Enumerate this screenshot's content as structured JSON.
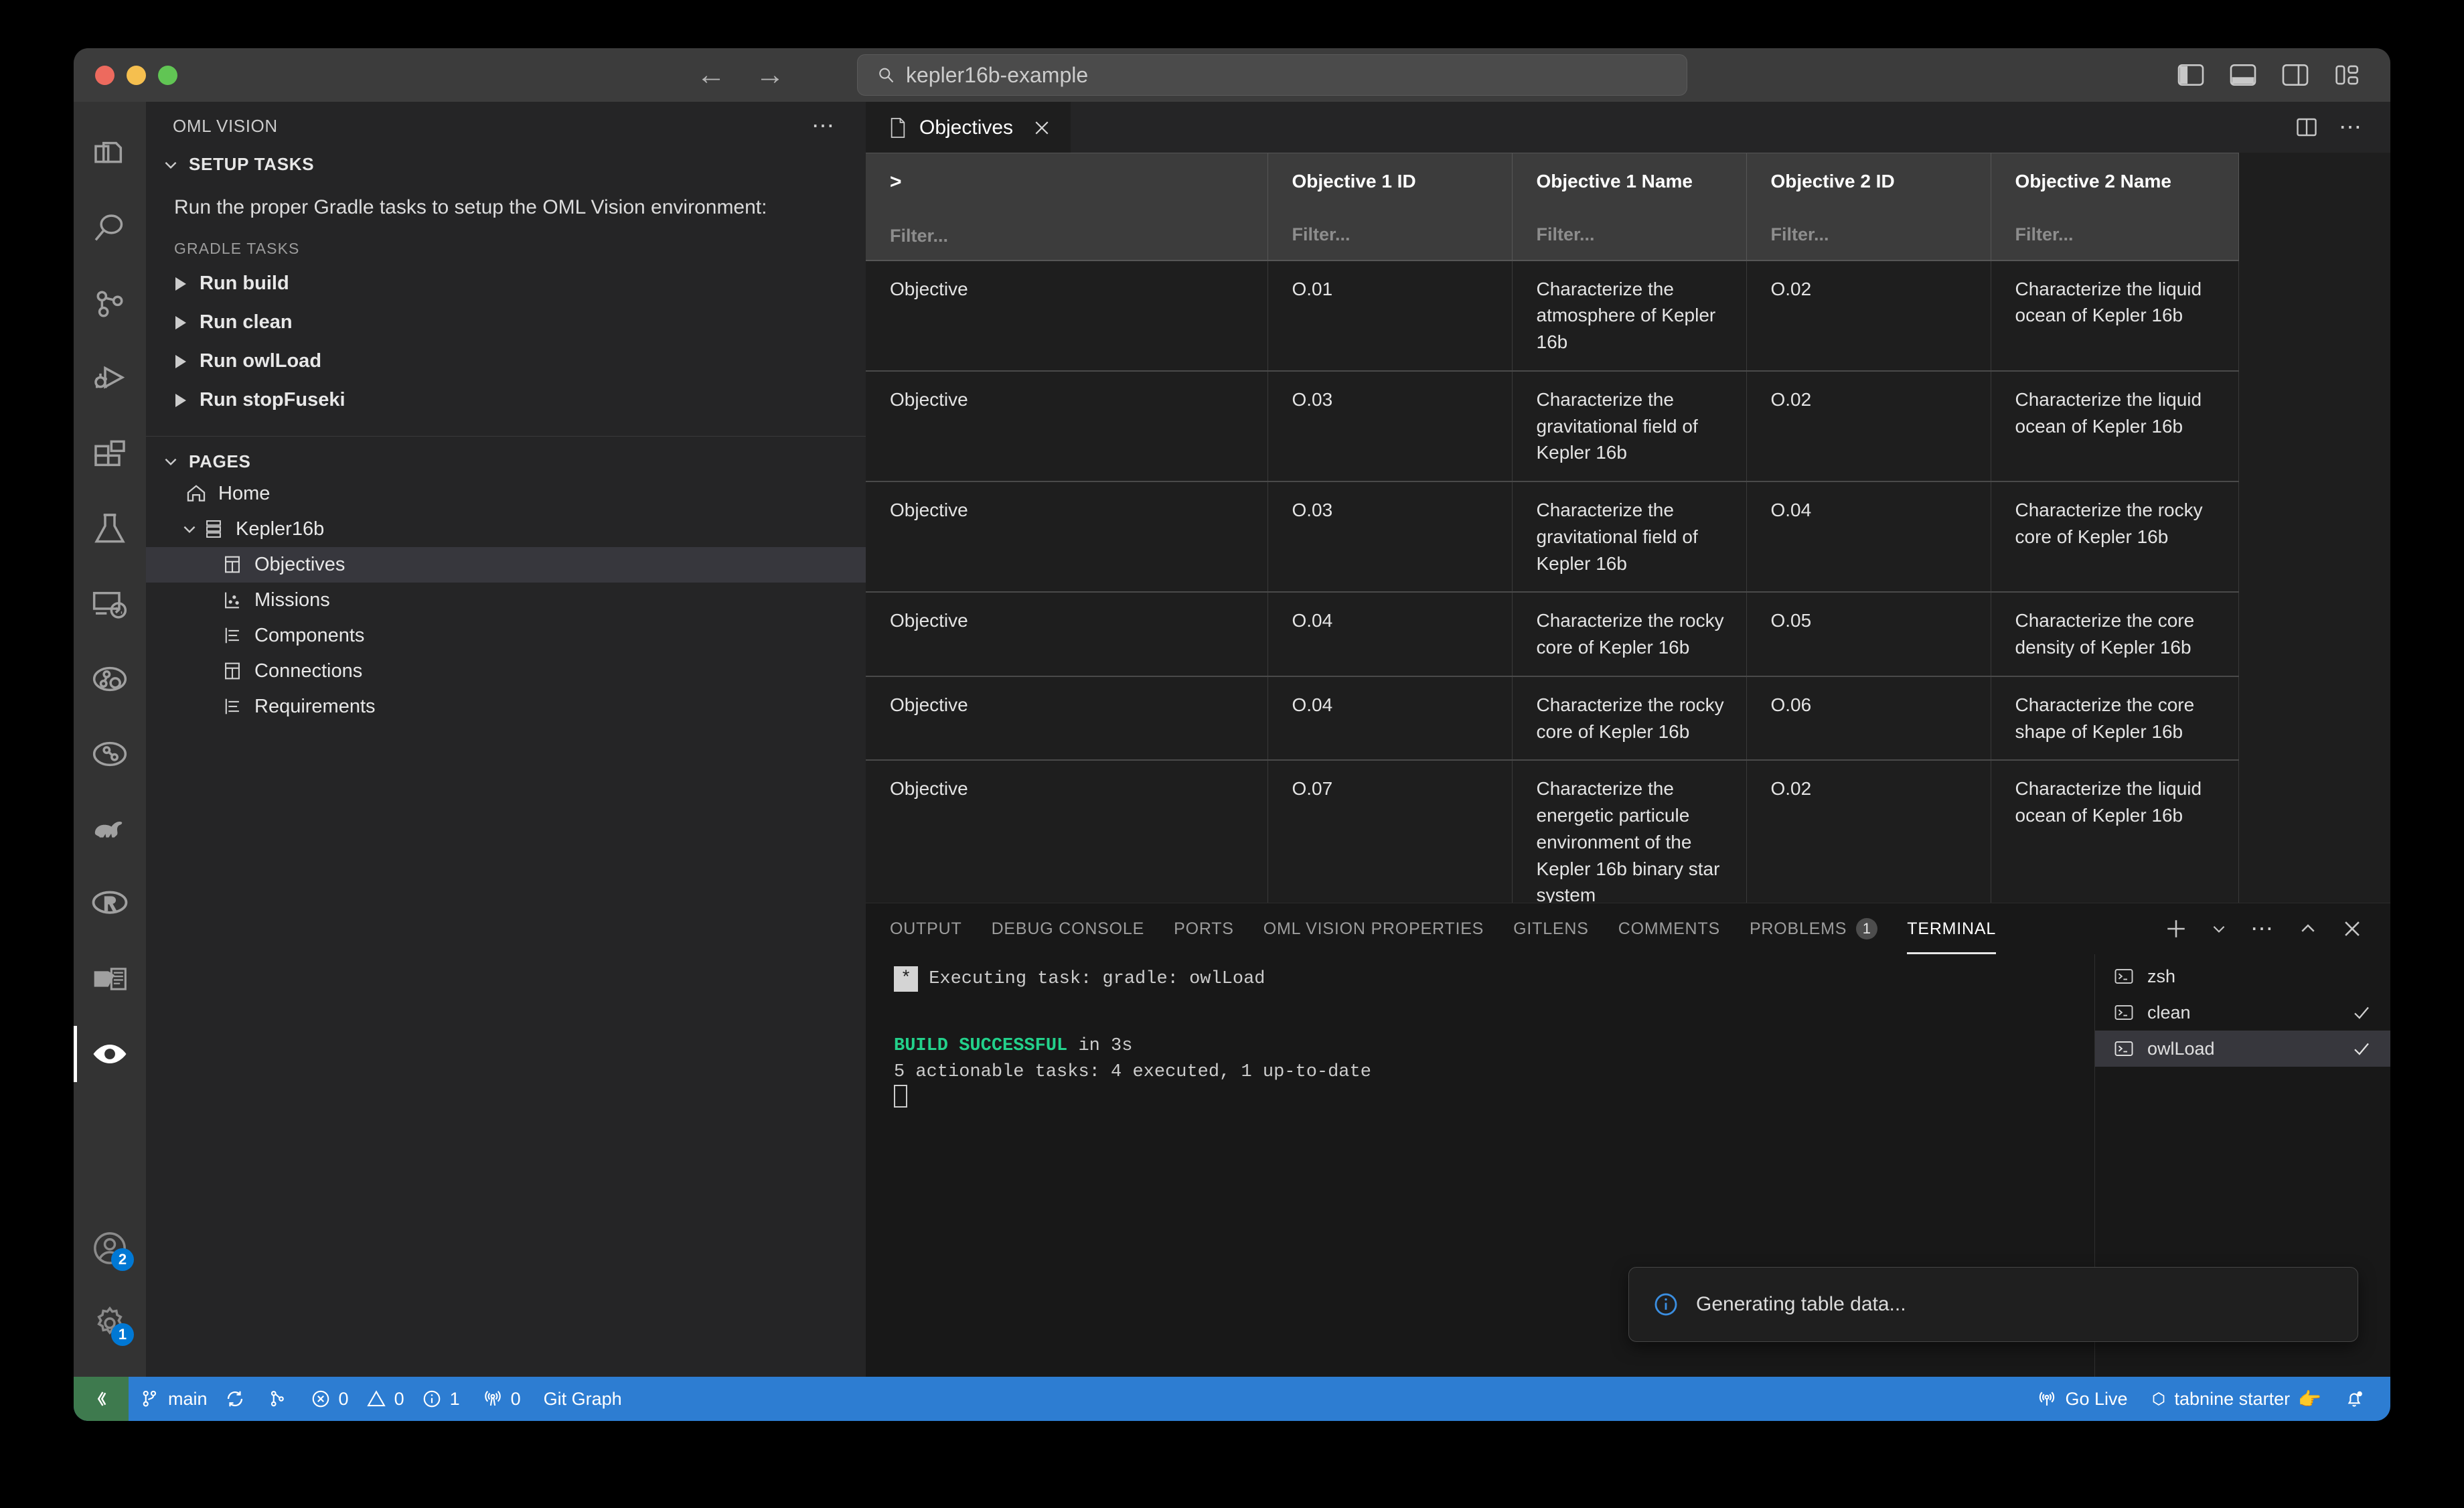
{
  "titlebar": {
    "search_value": "kepler16b-example",
    "search_icon": "search-icon",
    "back_icon": "back-arrow-icon",
    "forward_icon": "forward-arrow-icon",
    "layout_icons": [
      "toggle-primary-sidebar-icon",
      "toggle-panel-icon",
      "toggle-secondary-sidebar-icon",
      "customize-layout-icon"
    ]
  },
  "activitybar": {
    "items": [
      {
        "name": "explorer-icon"
      },
      {
        "name": "search-icon"
      },
      {
        "name": "source-control-icon"
      },
      {
        "name": "run-and-debug-icon"
      },
      {
        "name": "extensions-icon"
      },
      {
        "name": "testing-icon"
      },
      {
        "name": "remote-explorer-icon"
      },
      {
        "name": "graph-search-icon"
      },
      {
        "name": "graph-icon"
      },
      {
        "name": "gradle-elephant-icon"
      },
      {
        "name": "r-language-icon"
      },
      {
        "name": "oml-icon"
      },
      {
        "name": "oml-vision-eye-icon"
      }
    ],
    "bottom": [
      {
        "name": "accounts-icon",
        "badge": "2"
      },
      {
        "name": "settings-gear-icon",
        "badge": "1"
      }
    ]
  },
  "sidebar": {
    "title": "OML VISION",
    "more_icon": "more-actions-icon",
    "setup_section": {
      "label": "SETUP TASKS",
      "description": "Run the proper Gradle tasks to setup the OML Vision environment:",
      "subheader": "GRADLE TASKS",
      "tasks": [
        {
          "label": "Run build"
        },
        {
          "label": "Run clean"
        },
        {
          "label": "Run owlLoad"
        },
        {
          "label": "Run stopFuseki"
        }
      ]
    },
    "pages_section": {
      "label": "PAGES",
      "items": [
        {
          "label": "Home",
          "icon": "home-icon",
          "level": 1,
          "selected": false,
          "expandable": false
        },
        {
          "label": "Kepler16b",
          "icon": "layers-icon",
          "level": 1,
          "selected": false,
          "expandable": true
        },
        {
          "label": "Objectives",
          "icon": "table-icon",
          "level": 2,
          "selected": true,
          "expandable": false
        },
        {
          "label": "Missions",
          "icon": "chart-icon",
          "level": 2,
          "selected": false,
          "expandable": false
        },
        {
          "label": "Components",
          "icon": "tree-icon",
          "level": 2,
          "selected": false,
          "expandable": false
        },
        {
          "label": "Connections",
          "icon": "table-icon",
          "level": 2,
          "selected": false,
          "expandable": false
        },
        {
          "label": "Requirements",
          "icon": "tree-icon",
          "level": 2,
          "selected": false,
          "expandable": false
        }
      ]
    }
  },
  "editor": {
    "tab": {
      "label": "Objectives",
      "icon": "file-icon",
      "close_icon": "close-icon"
    },
    "actions": [
      {
        "name": "split-editor-icon"
      },
      {
        "name": "more-actions-icon"
      }
    ]
  },
  "table": {
    "filter_placeholder": "Filter...",
    "expand_icon": ">",
    "columns": [
      {
        "label": "",
        "key": "type"
      },
      {
        "label": "Objective 1 ID",
        "key": "o1id"
      },
      {
        "label": "Objective 1 Name",
        "key": "o1name"
      },
      {
        "label": "Objective 2 ID",
        "key": "o2id"
      },
      {
        "label": "Objective 2 Name",
        "key": "o2name"
      }
    ],
    "rows": [
      {
        "type": "Objective",
        "o1id": "O.01",
        "o1name": "Characterize the atmosphere of Kepler 16b",
        "o2id": "O.02",
        "o2name": "Characterize the liquid ocean of Kepler 16b"
      },
      {
        "type": "Objective",
        "o1id": "O.03",
        "o1name": "Characterize the gravitational field of Kepler 16b",
        "o2id": "O.02",
        "o2name": "Characterize the liquid ocean of Kepler 16b"
      },
      {
        "type": "Objective",
        "o1id": "O.03",
        "o1name": "Characterize the gravitational field of Kepler 16b",
        "o2id": "O.04",
        "o2name": "Characterize the rocky core of Kepler 16b"
      },
      {
        "type": "Objective",
        "o1id": "O.04",
        "o1name": "Characterize the rocky core of Kepler 16b",
        "o2id": "O.05",
        "o2name": "Characterize the core density of Kepler 16b"
      },
      {
        "type": "Objective",
        "o1id": "O.04",
        "o1name": "Characterize the rocky core of Kepler 16b",
        "o2id": "O.06",
        "o2name": "Characterize the core shape of Kepler 16b"
      },
      {
        "type": "Objective",
        "o1id": "O.07",
        "o1name": "Characterize the energetic particule environment of the Kepler 16b binary star system",
        "o2id": "O.02",
        "o2name": "Characterize the liquid ocean of Kepler 16b"
      }
    ]
  },
  "panel": {
    "tabs": [
      {
        "label": "OUTPUT",
        "active": false
      },
      {
        "label": "DEBUG CONSOLE",
        "active": false
      },
      {
        "label": "PORTS",
        "active": false
      },
      {
        "label": "OML VISION PROPERTIES",
        "active": false
      },
      {
        "label": "GITLENS",
        "active": false
      },
      {
        "label": "COMMENTS",
        "active": false
      },
      {
        "label": "PROBLEMS",
        "active": false,
        "badge": "1"
      },
      {
        "label": "TERMINAL",
        "active": true
      }
    ],
    "actions": [
      {
        "name": "new-terminal-icon"
      },
      {
        "name": "chevron-down-icon"
      },
      {
        "name": "more-actions-icon"
      },
      {
        "name": "maximize-panel-icon"
      },
      {
        "name": "close-panel-icon"
      }
    ],
    "terminal": {
      "task_line": "Executing task: gradle: owlLoad",
      "task_marker": "*",
      "build_status": "BUILD SUCCESSFUL",
      "build_time": " in 3s",
      "tasks_summary": "5 actionable tasks: 4 executed, 1 up-to-date"
    },
    "terminal_list": [
      {
        "label": "zsh",
        "icon": "terminal-icon",
        "selected": false,
        "check": false
      },
      {
        "label": "clean",
        "icon": "terminal-icon",
        "selected": false,
        "check": true
      },
      {
        "label": "owlLoad",
        "icon": "terminal-icon",
        "selected": true,
        "check": true
      }
    ]
  },
  "toast": {
    "icon": "info-icon",
    "message": "Generating table data..."
  },
  "statusbar": {
    "remote_icon": "remote-window-icon",
    "branch": "main",
    "branch_icon": "source-control-branch-icon",
    "sync_icon": "sync-icon",
    "branch_compare_icon": "git-compare-icon",
    "errors": "0",
    "warnings": "0",
    "infos": "1",
    "radio_tower_count": "0",
    "git_graph": "Git Graph",
    "go_live": "Go Live",
    "tabnine": "tabnine starter",
    "tabnine_emoji": "👉",
    "bell_icon": "notifications-bell-icon"
  },
  "colors": {
    "accent": "#2d7dd2",
    "remote": "#3e7a4e",
    "success": "#23d18b",
    "badge": "#0078d4"
  }
}
